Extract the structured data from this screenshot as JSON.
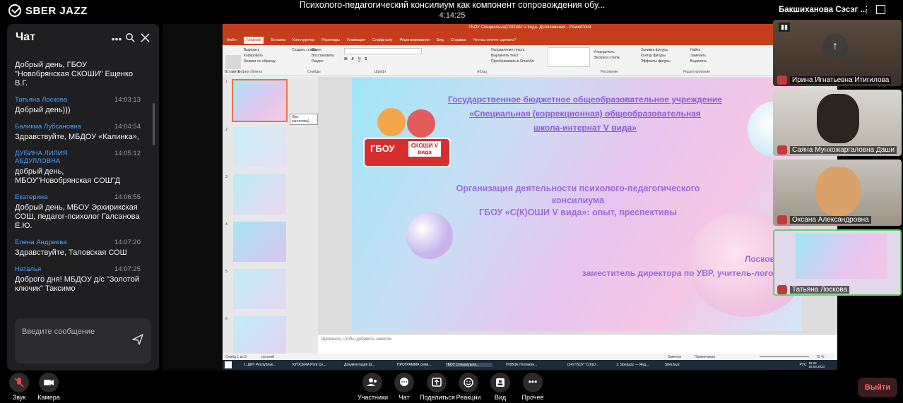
{
  "app": {
    "logo_text": "SBER JAZZ"
  },
  "meeting": {
    "title": "Психолого-педагогический консилиум как компонент сопровождения обу...",
    "time": "4:14:25"
  },
  "chat": {
    "title": "Чат",
    "input_placeholder": "Введите сообщение",
    "messages": [
      {
        "name": "",
        "time": "",
        "text": "Добрый день, ГБОУ \"Новобрянская СКОШИ\" Ещенко В.Г."
      },
      {
        "name": "Татьяна Лоскова",
        "time": "14:03:13",
        "text": "Добрый день)))"
      },
      {
        "name": "Баликма Лубсановна",
        "time": "14:04:54",
        "text": "Здравствуйте, МБДОУ «Калинка»,"
      },
      {
        "name": "ДУБИНА ЛИЛИЯ АБДУЛЛОВНА",
        "time": "14:05:12",
        "text": "добрый день, МБОУ\"Новобрянская СОШ\"Д"
      },
      {
        "name": "Екатерина",
        "time": "14:06:55",
        "text": "Добрый день, МБОУ Эрхирикская СОШ, педагог-психолог Галсанова Е.Ю."
      },
      {
        "name": "Елена Андреева",
        "time": "14:07:20",
        "text": "Здравствуйте, Таловская СОШ"
      },
      {
        "name": "Наталья",
        "time": "14:07:25",
        "text": "Доброго дня! МБДОУ д/с \"Золотой ключик\" Таксимо"
      }
    ]
  },
  "ppt": {
    "window_title": "ГБОУ Специальна(СКОШИ V вида. Дополненная - PowerPoint",
    "tabs": [
      "Файл",
      "Главная",
      "Вставка",
      "Конструктор",
      "Переходы",
      "Анимация",
      "Слайд-шоу",
      "Рецензирование",
      "Вид",
      "Справка",
      "Что вы хотите сделать?"
    ],
    "ribbon_groups": [
      "Буфер обмена",
      "Слайды",
      "Шрифт",
      "Абзац",
      "Рисование",
      "Редактирование"
    ],
    "ribbon_items": {
      "clipboard": [
        "Вырезать",
        "Копировать",
        "Формат по образцу"
      ],
      "insert_label": "Вставить",
      "slides": [
        "Макет",
        "Восстановить",
        "Раздел"
      ],
      "new_slide": "Создать слайд",
      "paragraph": [
        "Направление текста",
        "Выровнять текст",
        "Преобразовать в SmartArt"
      ],
      "drawing": [
        "Упорядочить",
        "Экспресс-стили",
        "Заливка фигуры",
        "Контур фигуры",
        "Эффекты фигуры"
      ],
      "editing": [
        "Найти",
        "Заменить",
        "Выделить"
      ]
    },
    "thumb_tooltip": "(без заголовка)",
    "slide_numbers": [
      "1",
      "2",
      "3",
      "4",
      "5",
      "6"
    ],
    "notes_placeholder": "Щелкните, чтобы добавить заметки",
    "status_left": "Слайд 1 из 9",
    "status_lang": "русский",
    "status_notes": "Заметки",
    "status_comments": "Примечания",
    "zoom": "73 %",
    "slide": {
      "logo_top": "ГБОУ",
      "logo_sub": "СКОШИ V вида",
      "org_lines": [
        "Государственное бюджетное общеобразовательное учреждение",
        "«Специальная (коррекционная) общеобразовательная",
        "школа-интернат V вида»"
      ],
      "topic_lines": [
        "Организация деятельности психолого-педагогического",
        "консилиума",
        "ГБОУ «С(К)ОШИ  V вида»: опыт, преспективы"
      ],
      "author_lines": [
        "Лоскова Т.",
        "заместитель директора по УВР, учитель-логопед"
      ]
    },
    "taskbar": [
      "1: ДИТ Республик...",
      "КYOCERA Print Ce...",
      "Документация Ш...",
      "ПРОГРАММА семи...",
      "ГБОУ Специальна...",
      "НОВОЕ Положен...",
      "(14) ГБОУ \"С(К)О...",
      "1: Sberjazz — Янд...",
      "SberJazz"
    ],
    "tray": {
      "lang": "РУС",
      "time": "15:22",
      "date": "28.03.2023"
    }
  },
  "participants": {
    "header_name": "Бакшиханова Сэсэг ...",
    "tiles": [
      {
        "name": "Ирина Игнатьевна Итигилова"
      },
      {
        "name": "Саяна Мунхожаргаловна Даши"
      },
      {
        "name": "Оксана Александровна"
      },
      {
        "name": "Татьяна Лоскова"
      }
    ]
  },
  "controls": {
    "left": [
      {
        "label": "Звук"
      },
      {
        "label": "Камера"
      }
    ],
    "center": [
      {
        "label": "Участники"
      },
      {
        "label": "Чат"
      },
      {
        "label": "Поделиться"
      },
      {
        "label": "Реакции"
      },
      {
        "label": "Вид"
      },
      {
        "label": "Прочее"
      }
    ],
    "exit_label": "Выйти"
  },
  "colors": {
    "accent_blue": "#4aa3ff",
    "ppt_orange": "#c43e1c",
    "exit_red": "#3b1d1d",
    "slide_text": "#8a5ad6"
  }
}
